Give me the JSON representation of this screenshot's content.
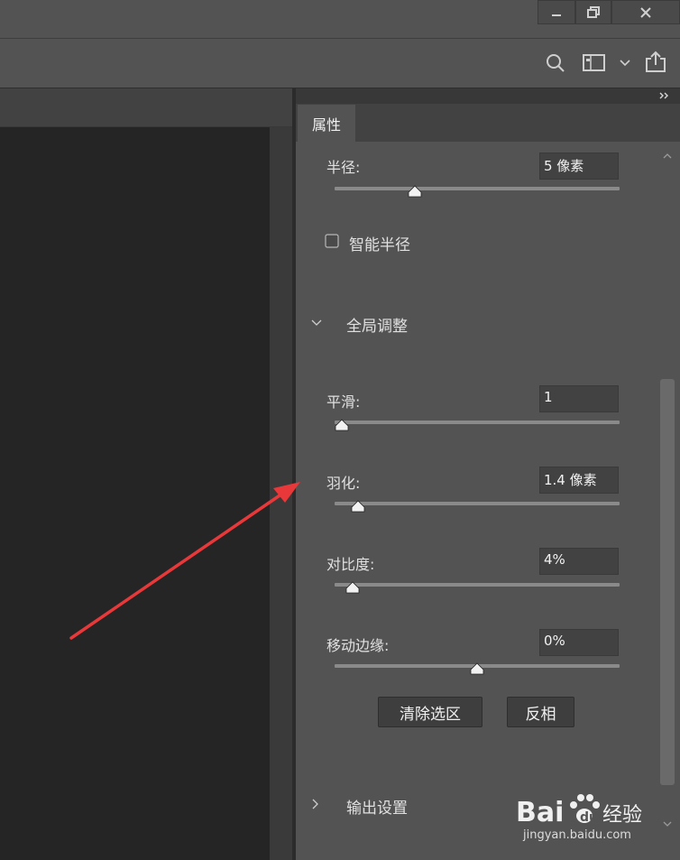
{
  "tabs": {
    "properties": "属性"
  },
  "panel": {
    "radius": {
      "label": "半径:",
      "value": "5 像素",
      "slider": 0.27
    },
    "smart_radius": {
      "label": "智能半径",
      "checked": false
    },
    "global_section": {
      "label": "全局调整",
      "expanded": true
    },
    "smooth": {
      "label": "平滑:",
      "value": "1",
      "slider": 0.0
    },
    "feather": {
      "label": "羽化:",
      "value": "1.4 像素",
      "slider": 0.06
    },
    "contrast": {
      "label": "对比度:",
      "value": "4%",
      "slider": 0.04
    },
    "shift_edge": {
      "label": "移动边缘:",
      "value": "0%",
      "slider": 0.5
    },
    "buttons": {
      "clear_selection": "清除选区",
      "invert": "反相"
    },
    "output_section": {
      "label": "输出设置",
      "expanded": false
    }
  },
  "watermark": {
    "logo_text": "Bai经验",
    "url": "jingyan.baidu.com"
  },
  "icons": {
    "window": [
      "minimize-icon",
      "restore-icon",
      "close-icon"
    ],
    "options": [
      "search-icon",
      "workspace-icon",
      "chevron-down-icon",
      "share-icon"
    ],
    "panel": [
      "double-chevron-right-icon",
      "chevron-down-icon",
      "chevron-right-icon",
      "scroll-up-icon",
      "scroll-down-icon"
    ]
  },
  "colors": {
    "annotation_arrow": "#e8383a",
    "panel_bg": "#535353",
    "canvas_bg": "#252525"
  }
}
